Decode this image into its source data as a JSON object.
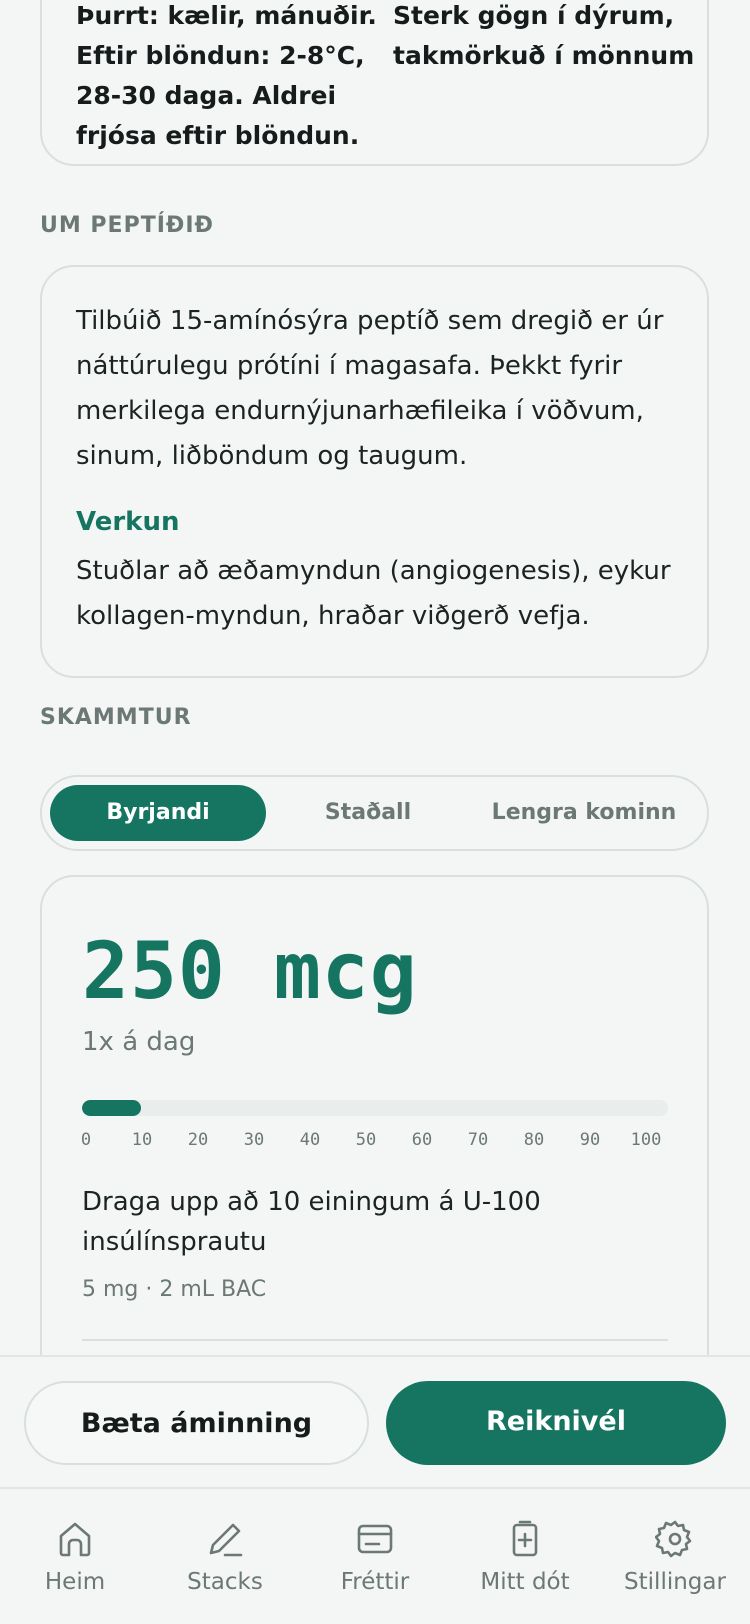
{
  "storage": {
    "left_lines": [
      "Þurrt: kælir, mánuðir.",
      "Eftir blöndun: 2-8°C,",
      "28-30 daga. Aldrei",
      "frjósa eftir blöndun."
    ],
    "right_lines": [
      "Sterk gögn í dýrum,",
      "takmörkuð í mönnum"
    ]
  },
  "about": {
    "section_label": "UM PEPTÍÐIÐ",
    "description_lines": [
      "Tilbúið 15-amínósýra peptíð sem dregið er úr",
      "náttúrulegu prótíni í magasafa. Þekkt fyrir",
      "merkilega endurnýjunarhæfileika í vöðvum,",
      "sinum, liðböndum og taugum."
    ],
    "effect_heading": "Verkun",
    "effect_lines": [
      "Stuðlar að æðamyndun (angiogenesis), eykur",
      "kollagen-myndun, hraðar viðgerð vefja."
    ]
  },
  "dosage": {
    "section_label": "SKAMMTUR",
    "options": [
      "Byrjandi",
      "Staðall",
      "Lengra kominn"
    ],
    "selected": "Byrjandi",
    "amount": "250 mcg",
    "frequency": "1x á dag",
    "units_drawn": 10,
    "scale_max": 100,
    "scale_ticks": [
      "0",
      "10",
      "20",
      "30",
      "40",
      "50",
      "60",
      "70",
      "80",
      "90",
      "100"
    ],
    "instruction_lines": [
      "Draga upp að 10 einingum á U-100",
      "insúlínsprautu"
    ],
    "vial_info": "5 mg · 2 mL BAC"
  },
  "actions": {
    "reminder_label": "Bæta áminning",
    "calculator_label": "Reiknivél"
  },
  "tabs": [
    {
      "label": "Heim",
      "icon": "home-icon"
    },
    {
      "label": "Stacks",
      "icon": "pencil-icon"
    },
    {
      "label": "Fréttir",
      "icon": "news-card-icon"
    },
    {
      "label": "Mitt dót",
      "icon": "vial-plus-icon"
    },
    {
      "label": "Stillingar",
      "icon": "gear-icon"
    }
  ],
  "colors": {
    "accent": "#157561",
    "background": "#f3f6f5",
    "muted_text": "#6c7875",
    "border": "#d8dfdc"
  }
}
